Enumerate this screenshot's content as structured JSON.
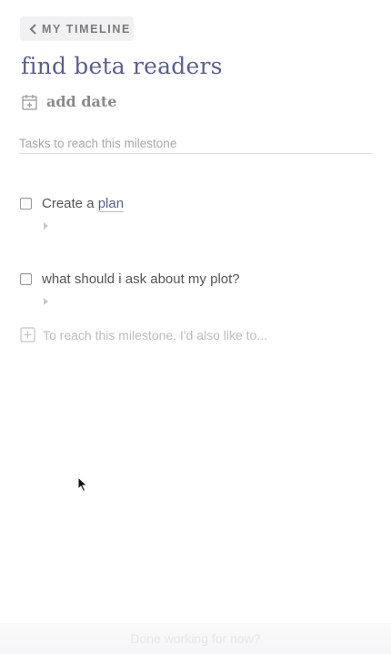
{
  "header": {
    "back_label": "MY TIMELINE",
    "title": "find beta readers"
  },
  "date": {
    "add_label": "add date"
  },
  "tasks_section": {
    "label": "Tasks to reach this milestone",
    "tasks": [
      {
        "text_prefix": "Create a ",
        "link_text": "plan",
        "checked": false
      },
      {
        "text": "what should i ask about my plot?",
        "checked": false
      }
    ],
    "add_placeholder": "To reach this milestone, I'd also like to..."
  },
  "footer": {
    "done_label": "Done working for now?"
  },
  "icons": {
    "back": "chevron-left-icon",
    "date": "calendar-plus-icon",
    "add": "plus-square-icon",
    "cursor": "mouse-pointer-icon"
  }
}
